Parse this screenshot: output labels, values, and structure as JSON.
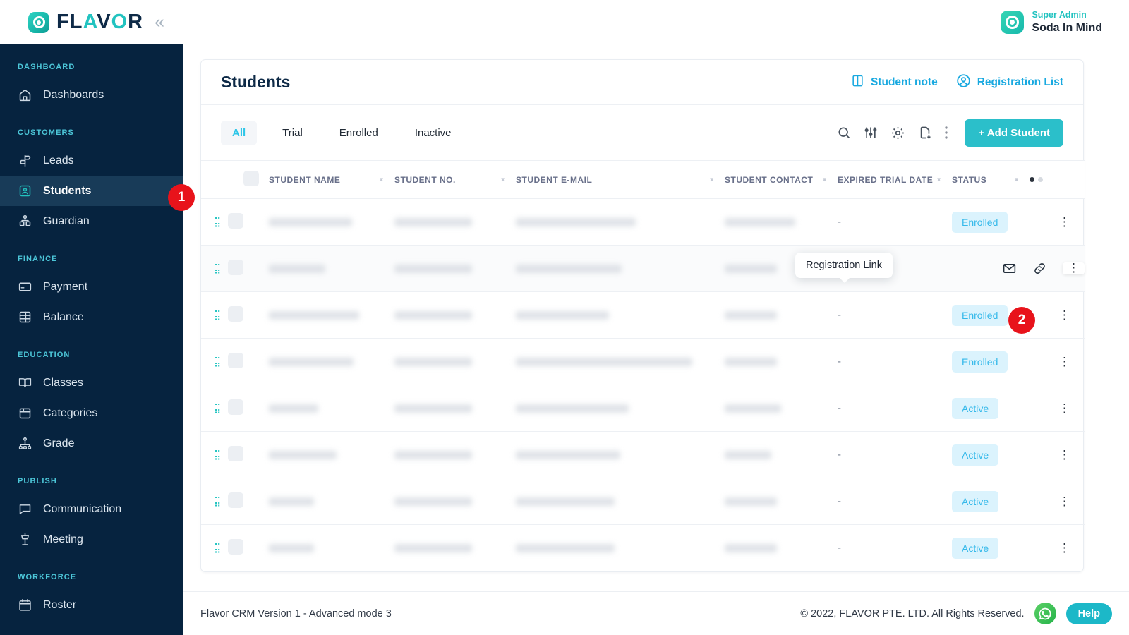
{
  "topbar": {
    "brand_flavor_part1": "FL",
    "brand_flavor_accent": "A",
    "brand_flavor_part2": "V",
    "brand_flavor_accent2": "O",
    "brand_text": "FLAVOR",
    "collapse_label": "«",
    "user_role": "Super Admin",
    "user_name": "Soda In Mind"
  },
  "sidebar": {
    "groups": [
      {
        "label": "DASHBOARD",
        "items": [
          {
            "label": "Dashboards",
            "icon": "home-icon",
            "active": false
          }
        ]
      },
      {
        "label": "CUSTOMERS",
        "items": [
          {
            "label": "Leads",
            "icon": "signpost-icon",
            "active": false
          },
          {
            "label": "Students",
            "icon": "student-card-icon",
            "active": true
          },
          {
            "label": "Guardian",
            "icon": "guardian-icon",
            "active": false
          }
        ]
      },
      {
        "label": "FINANCE",
        "items": [
          {
            "label": "Payment",
            "icon": "credit-card-icon",
            "active": false
          },
          {
            "label": "Balance",
            "icon": "balance-icon",
            "active": false
          }
        ]
      },
      {
        "label": "EDUCATION",
        "items": [
          {
            "label": "Classes",
            "icon": "book-icon",
            "active": false
          },
          {
            "label": "Categories",
            "icon": "box-icon",
            "active": false
          },
          {
            "label": "Grade",
            "icon": "hierarchy-icon",
            "active": false
          }
        ]
      },
      {
        "label": "PUBLISH",
        "items": [
          {
            "label": "Communication",
            "icon": "chat-icon",
            "active": false
          },
          {
            "label": "Meeting",
            "icon": "podium-icon",
            "active": false
          }
        ]
      },
      {
        "label": "WORKFORCE",
        "items": [
          {
            "label": "Roster",
            "icon": "calendar-icon",
            "active": false
          }
        ]
      }
    ]
  },
  "page": {
    "title": "Students",
    "head_actions": [
      {
        "label": "Student note",
        "icon": "note-book-icon"
      },
      {
        "label": "Registration List",
        "icon": "user-circle-icon"
      }
    ],
    "tabs": [
      {
        "label": "All",
        "active": true
      },
      {
        "label": "Trial",
        "active": false
      },
      {
        "label": "Enrolled",
        "active": false
      },
      {
        "label": "Inactive",
        "active": false
      }
    ],
    "tools": [
      {
        "name": "search-icon"
      },
      {
        "name": "filter-sliders-icon"
      },
      {
        "name": "gear-icon"
      },
      {
        "name": "export-document-icon"
      },
      {
        "name": "more-vertical-icon"
      }
    ],
    "add_button": "+ Add Student"
  },
  "table": {
    "columns": [
      {
        "label": "STUDENT NAME",
        "sortable": true
      },
      {
        "label": "STUDENT NO.",
        "sortable": true
      },
      {
        "label": "STUDENT E-MAIL",
        "sortable": true
      },
      {
        "label": "STUDENT CONTACT",
        "sortable": true
      },
      {
        "label": "EXPIRED TRIAL DATE",
        "sortable": true
      },
      {
        "label": "STATUS",
        "sortable": true
      }
    ],
    "rows": [
      {
        "name_w": 118,
        "no_w": 110,
        "email_w": 170,
        "contact_w": 100,
        "expired": "-",
        "status": "Enrolled",
        "hovered": false,
        "show_icons": false
      },
      {
        "name_w": 80,
        "no_w": 110,
        "email_w": 150,
        "contact_w": 74,
        "expired": "-",
        "status": "",
        "hovered": true,
        "show_icons": true
      },
      {
        "name_w": 128,
        "no_w": 110,
        "email_w": 132,
        "contact_w": 74,
        "expired": "-",
        "status": "Enrolled",
        "hovered": false,
        "show_icons": false
      },
      {
        "name_w": 120,
        "no_w": 110,
        "email_w": 250,
        "contact_w": 74,
        "expired": "-",
        "status": "Enrolled",
        "hovered": false,
        "show_icons": false
      },
      {
        "name_w": 70,
        "no_w": 110,
        "email_w": 160,
        "contact_w": 80,
        "expired": "-",
        "status": "Active",
        "hovered": false,
        "show_icons": false
      },
      {
        "name_w": 96,
        "no_w": 110,
        "email_w": 148,
        "contact_w": 66,
        "expired": "-",
        "status": "Active",
        "hovered": false,
        "show_icons": false
      },
      {
        "name_w": 64,
        "no_w": 110,
        "email_w": 140,
        "contact_w": 74,
        "expired": "-",
        "status": "Active",
        "hovered": false,
        "show_icons": false
      },
      {
        "name_w": 64,
        "no_w": 110,
        "email_w": 140,
        "contact_w": 74,
        "expired": "-",
        "status": "Active",
        "hovered": false,
        "show_icons": false
      }
    ]
  },
  "tooltip": {
    "text": "Registration Link"
  },
  "annotations": [
    {
      "number": "1"
    },
    {
      "number": "2"
    }
  ],
  "footer": {
    "version": "Flavor CRM Version 1 - Advanced mode 3",
    "copyright": "© 2022, FLAVOR PTE. LTD. All Rights Reserved.",
    "help_label": "Help"
  },
  "colors": {
    "brand_teal": "#22c3c0",
    "sidebar_bg": "#06233f",
    "accent_blue": "#19a9e0",
    "badge_bg": "#dbf3fd",
    "badge_text": "#35b9ea",
    "annotation_red": "#e8131b",
    "add_button": "#2bbfca"
  }
}
